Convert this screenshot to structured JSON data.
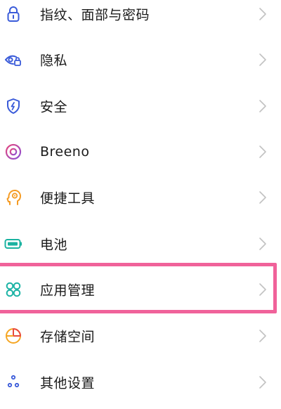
{
  "settings": {
    "items": [
      {
        "label": "指纹、面部与密码",
        "icon": "lock-icon"
      },
      {
        "label": "隐私",
        "icon": "privacy-eye-icon"
      },
      {
        "label": "安全",
        "icon": "shield-icon"
      },
      {
        "label": "Breeno",
        "icon": "breeno-icon"
      },
      {
        "label": "便捷工具",
        "icon": "convenience-tools-icon"
      },
      {
        "label": "电池",
        "icon": "battery-icon"
      },
      {
        "label": "应用管理",
        "icon": "app-management-icon"
      },
      {
        "label": "存储空间",
        "icon": "storage-pie-icon"
      },
      {
        "label": "其他设置",
        "icon": "other-settings-icon"
      }
    ],
    "highlighted_item": "应用管理"
  },
  "colors": {
    "icon_blue": "#3a5bd9",
    "breeno_pink": "#e5487f",
    "breeno_purple": "#8a4fd6",
    "tools_orange": "#f59b23",
    "battery_teal": "#19b2a0",
    "app_teal": "#1fb4a6",
    "storage_orange": "#f5a623",
    "storage_red": "#e8493f",
    "highlight": "#f0629a",
    "chevron": "#c2c2c2",
    "text": "#1a1a1a"
  }
}
